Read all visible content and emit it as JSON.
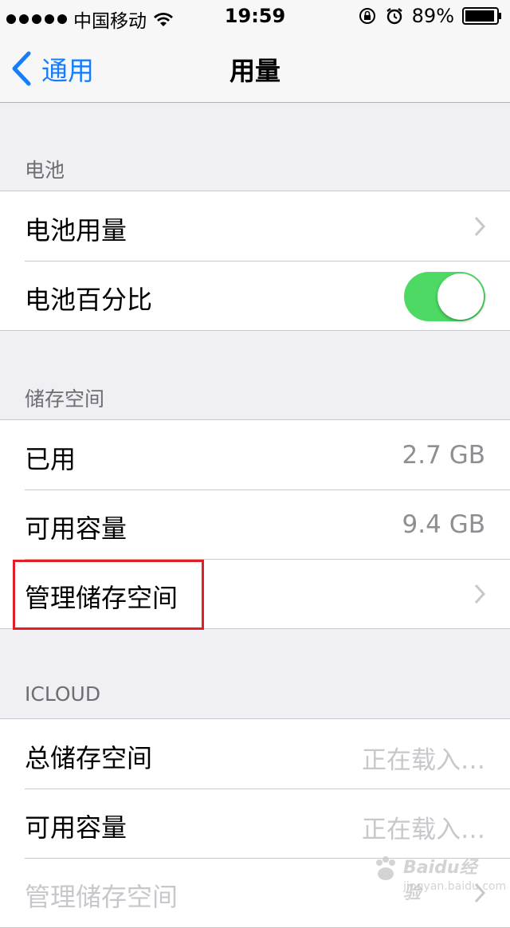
{
  "status_bar": {
    "carrier": "中国移动",
    "time": "19:59",
    "battery_percent": "89%",
    "icons": [
      "signal-dots-icon",
      "wifi-icon",
      "rotation-lock-icon",
      "alarm-icon",
      "battery-icon"
    ]
  },
  "nav": {
    "back_label": "通用",
    "title": "用量"
  },
  "sections": {
    "battery": {
      "header": "电池",
      "rows": [
        {
          "label": "电池用量"
        },
        {
          "label": "电池百分比",
          "toggle_on": true
        }
      ]
    },
    "storage": {
      "header": "储存空间",
      "rows": [
        {
          "label": "已用",
          "value": "2.7 GB"
        },
        {
          "label": "可用容量",
          "value": "9.4 GB"
        },
        {
          "label": "管理储存空间"
        }
      ]
    },
    "icloud": {
      "header": "ICLOUD",
      "rows": [
        {
          "label": "总储存空间",
          "value": "正在载入…"
        },
        {
          "label": "可用容量",
          "value": "正在载入…"
        },
        {
          "label": "管理储存空间"
        }
      ]
    }
  },
  "colors": {
    "accent": "#157efb",
    "toggle_on": "#4cd964",
    "highlight": "#e01f26",
    "background": "#efeff4"
  },
  "watermark": {
    "brand": "Baidu经验",
    "url": "jingyan.baidu.com"
  }
}
